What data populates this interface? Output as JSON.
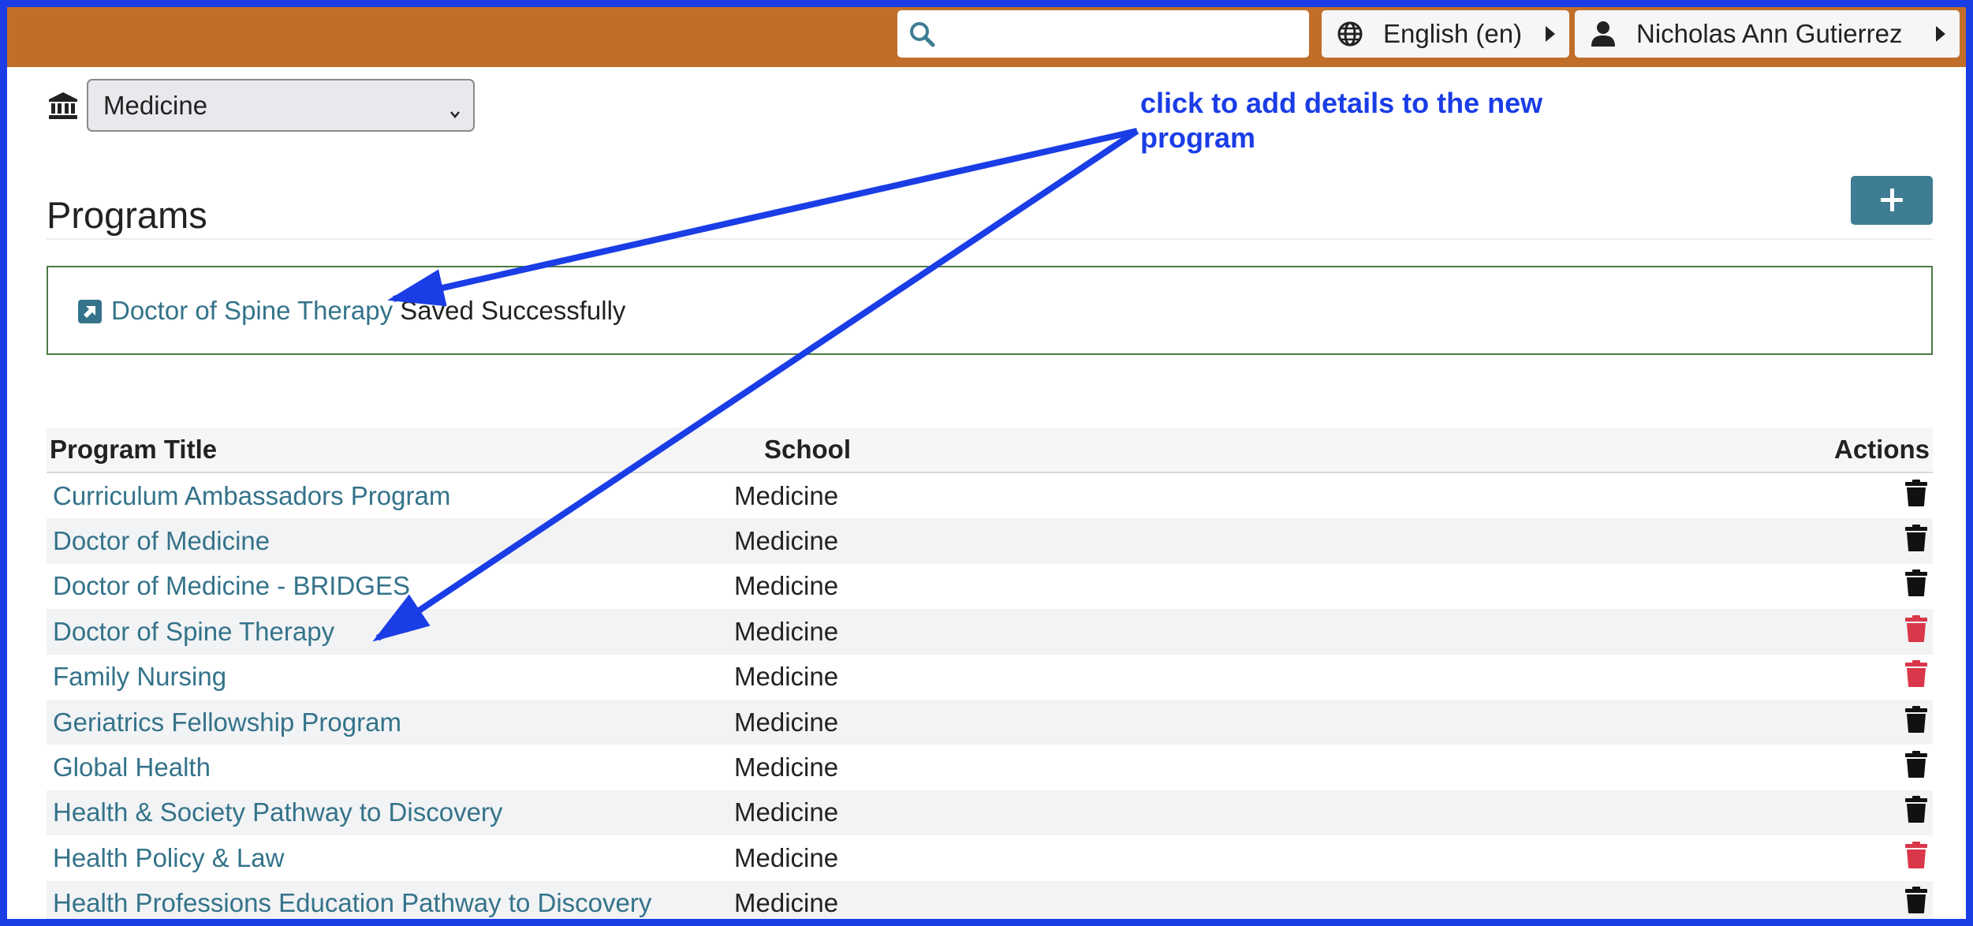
{
  "header": {
    "search": {
      "placeholder": "",
      "value": ""
    },
    "language_label": "English (en)",
    "user_label": "Nicholas Ann Gutierrez"
  },
  "school_selector": {
    "selected": "Medicine",
    "options": [
      "Medicine"
    ]
  },
  "page": {
    "title": "Programs",
    "add_button_icon": "plus-icon"
  },
  "alert": {
    "link_text": "Doctor of Spine Therapy",
    "message": " Saved Successfully"
  },
  "table": {
    "columns": {
      "title": "Program Title",
      "school": "School",
      "actions": "Actions"
    },
    "rows": [
      {
        "title": "Curriculum Ambassadors Program",
        "school": "Medicine",
        "delete_color": "#111111"
      },
      {
        "title": "Doctor of Medicine",
        "school": "Medicine",
        "delete_color": "#111111"
      },
      {
        "title": "Doctor of Medicine - BRIDGES",
        "school": "Medicine",
        "delete_color": "#111111"
      },
      {
        "title": "Doctor of Spine Therapy",
        "school": "Medicine",
        "delete_color": "#d9374a"
      },
      {
        "title": "Family Nursing",
        "school": "Medicine",
        "delete_color": "#d9374a"
      },
      {
        "title": "Geriatrics Fellowship Program",
        "school": "Medicine",
        "delete_color": "#111111"
      },
      {
        "title": "Global Health",
        "school": "Medicine",
        "delete_color": "#111111"
      },
      {
        "title": "Health & Society Pathway to Discovery",
        "school": "Medicine",
        "delete_color": "#111111"
      },
      {
        "title": "Health Policy & Law",
        "school": "Medicine",
        "delete_color": "#d9374a"
      },
      {
        "title": "Health Professions Education Pathway to Discovery",
        "school": "Medicine",
        "delete_color": "#111111"
      }
    ]
  },
  "annotation": {
    "text": "click to add details to the new program",
    "color": "#1a3de6"
  },
  "colors": {
    "topbar": "#c16e2a",
    "link": "#34738a",
    "primary_button": "#3e7d93",
    "frame": "#1a3de6",
    "danger": "#d9374a"
  }
}
